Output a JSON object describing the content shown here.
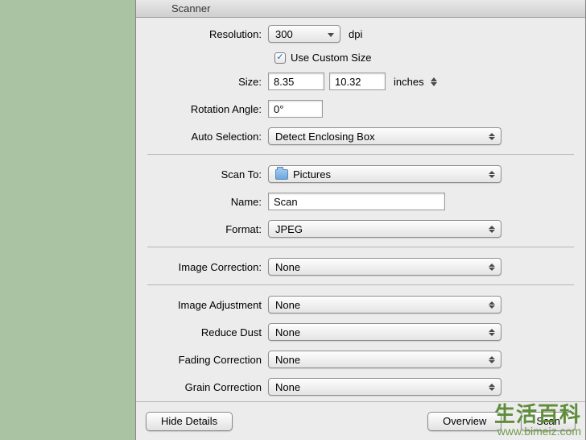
{
  "window": {
    "title": "Scanner"
  },
  "resolution": {
    "label": "Resolution:",
    "value": "300",
    "unit": "dpi"
  },
  "use_custom_size": {
    "label": "Use Custom Size",
    "checked": true
  },
  "size": {
    "label": "Size:",
    "width": "8.35",
    "height": "10.32",
    "unit": "inches"
  },
  "rotation": {
    "label": "Rotation Angle:",
    "value": "0°"
  },
  "auto_selection": {
    "label": "Auto Selection:",
    "value": "Detect Enclosing Box"
  },
  "scan_to": {
    "label": "Scan To:",
    "value": "Pictures"
  },
  "name": {
    "label": "Name:",
    "value": "Scan"
  },
  "format": {
    "label": "Format:",
    "value": "JPEG"
  },
  "image_correction": {
    "label": "Image Correction:",
    "value": "None"
  },
  "image_adjustment": {
    "label": "Image Adjustment",
    "value": "None"
  },
  "reduce_dust": {
    "label": "Reduce Dust",
    "value": "None"
  },
  "fading_correction": {
    "label": "Fading Correction",
    "value": "None"
  },
  "grain_correction": {
    "label": "Grain Correction",
    "value": "None"
  },
  "buttons": {
    "hide_details": "Hide Details",
    "overview": "Overview",
    "scan": "Scan"
  },
  "watermark": {
    "line1": "生活百科",
    "line2": "www.bimeiz.com"
  }
}
